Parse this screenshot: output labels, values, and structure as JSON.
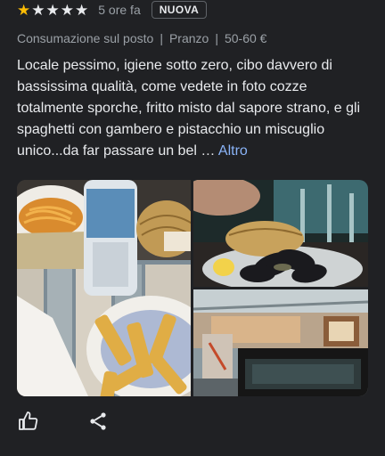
{
  "review": {
    "rating": 1,
    "max_rating": 5,
    "time_ago": "5 ore fa",
    "badge": "NUOVA",
    "meta": {
      "service": "Consumazione sul posto",
      "meal": "Pranzo",
      "price": "50-60 €",
      "separator": "|"
    },
    "text": "Locale pessimo, igiene sotto zero, cibo davvero di bassissima qualità, come vedete in foto cozze totalmente sporche, fritto misto dal sapore strano, e gli spaghetti con gambero e pistacchio un miscuglio unico...da far passare un bel … ",
    "more_label": "Altro"
  },
  "colors": {
    "background": "#202124",
    "star_on": "#fbbc04",
    "link": "#8ab4f8"
  },
  "photos": [
    {
      "icon": "photo-fries-spaghetti"
    },
    {
      "icon": "photo-mussels"
    },
    {
      "icon": "photo-restaurant-interior"
    }
  ],
  "actions": [
    {
      "icon": "thumb-up-icon"
    },
    {
      "icon": "share-icon"
    }
  ]
}
